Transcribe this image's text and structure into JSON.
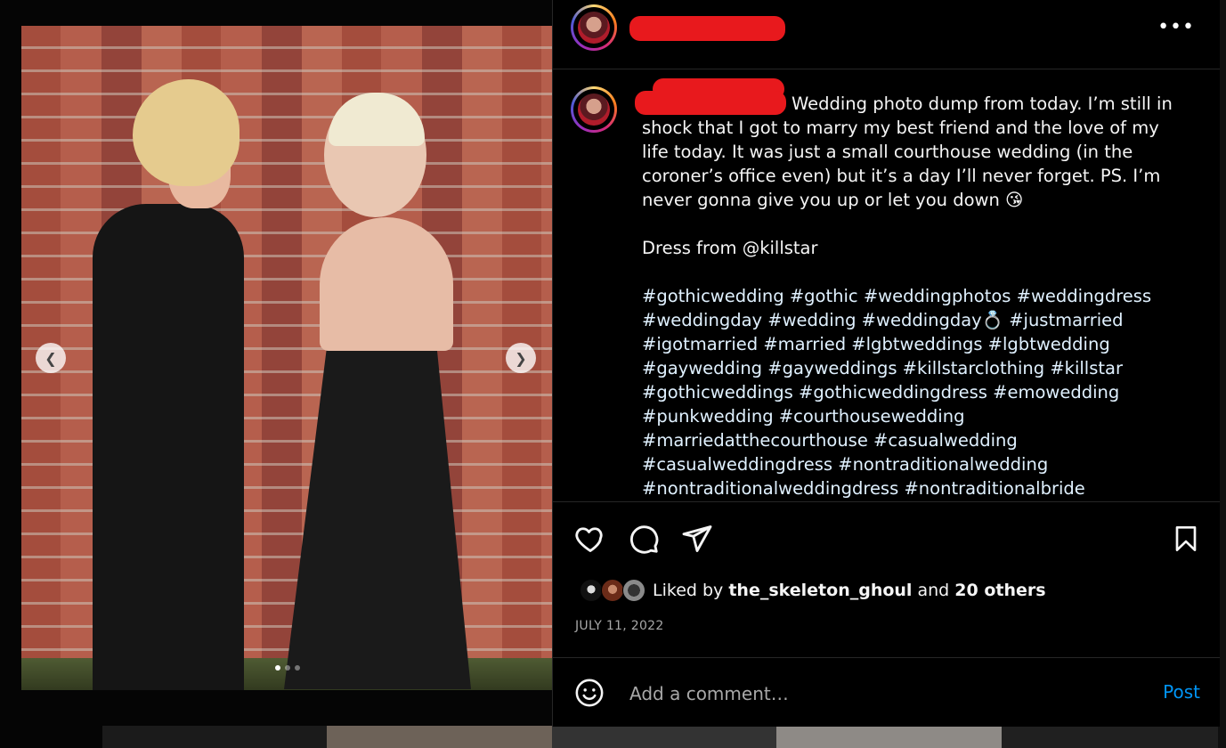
{
  "post": {
    "caption": {
      "text_1": "Wedding photo dump from today. I’m still in shock that I got to marry my best friend and the love of my life today. It was just a small courthouse wedding (in the coroner’s office even) but it’s a day I’ll never forget. PS. I’m never gonna give you up or let you down 😘",
      "text_2": "Dress from @killstar",
      "hashtags": "#gothicwedding #gothic #weddingphotos #weddingdress #weddingday #wedding #weddingday💍 #justmarried #igotmarried #married #lgbtweddings #lgbtwedding #gaywedding #gayweddings #killstarclothing #killstar #gothicweddings #gothicweddingdress #emowedding #punkwedding #courthousewedding #marriedatthecourthouse #casualwedding #casualweddingdress #nontraditionalwedding #nontraditionalweddingdress #nontraditionalbride #nontraditionalweddings #gothwedding #gothstyle"
    },
    "likes": {
      "prefix": "Liked by",
      "user": "the_skeleton_ghoul",
      "middle": "and",
      "others": "20 others"
    },
    "date": "JULY 11, 2022",
    "comment": {
      "placeholder": "Add a comment…",
      "post_label": "Post"
    },
    "carousel": {
      "slide_count": 3,
      "active_index": 0
    }
  },
  "icons": {
    "more": "more-options-icon",
    "like": "heart-icon",
    "comment": "comment-bubble-icon",
    "share": "paper-plane-icon",
    "save": "bookmark-icon",
    "emoji": "emoji-smile-icon",
    "prev": "chevron-left-icon",
    "next": "chevron-right-icon"
  },
  "colors": {
    "background": "#000000",
    "text": "#f5f5f5",
    "hashtag": "#e0f1ff",
    "muted": "#a8a8a8",
    "link": "#0095f6",
    "redaction": "#e8191d"
  }
}
